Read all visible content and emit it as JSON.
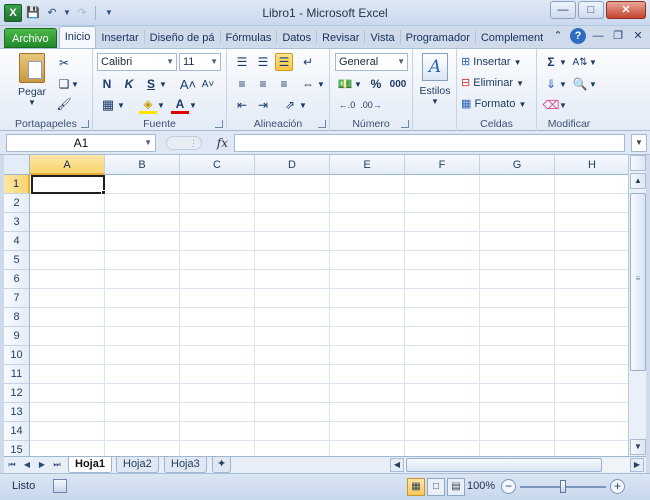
{
  "window": {
    "title": "Libro1 - Microsoft Excel",
    "controls": [
      "minimize-button",
      "maximize-button",
      "close-button"
    ]
  },
  "qat": {
    "app_icon": "X"
  },
  "tabs": [
    {
      "label": "Archivo",
      "key": "file"
    },
    {
      "label": "Inicio",
      "key": "home",
      "active": true
    },
    {
      "label": "Insertar",
      "key": "insert"
    },
    {
      "label": "Diseño de pá",
      "key": "page-layout"
    },
    {
      "label": "Fórmulas",
      "key": "formulas"
    },
    {
      "label": "Datos",
      "key": "data"
    },
    {
      "label": "Revisar",
      "key": "review"
    },
    {
      "label": "Vista",
      "key": "view"
    },
    {
      "label": "Programador",
      "key": "developer"
    },
    {
      "label": "Complement",
      "key": "addins"
    }
  ],
  "ribbon": {
    "clipboard": {
      "label": "Portapapeles",
      "paste": "Pegar"
    },
    "font": {
      "label": "Fuente",
      "font_name": "Calibri",
      "font_size": "11",
      "bold": "N",
      "italic": "K",
      "underline": "S"
    },
    "alignment": {
      "label": "Alineación"
    },
    "number": {
      "label": "Número",
      "format": "General",
      "percent": "%",
      "thousands": "000"
    },
    "styles": {
      "label": "Estilos"
    },
    "cells": {
      "label": "Celdas",
      "insert": "Insertar",
      "delete": "Eliminar",
      "format": "Formato"
    },
    "editing": {
      "label": "Modificar"
    }
  },
  "formula_bar": {
    "name_box": "A1",
    "fx": "fx",
    "formula": ""
  },
  "columns": [
    "A",
    "B",
    "C",
    "D",
    "E",
    "F",
    "G",
    "H"
  ],
  "rows": [
    "1",
    "2",
    "3",
    "4",
    "5",
    "6",
    "7",
    "8",
    "9",
    "10",
    "11",
    "12",
    "13",
    "14",
    "15"
  ],
  "active_cell": "A1",
  "sheets": [
    {
      "name": "Hoja1",
      "active": true
    },
    {
      "name": "Hoja2"
    },
    {
      "name": "Hoja3"
    }
  ],
  "status": {
    "text": "Listo",
    "zoom": "100%",
    "zoom_value": 100
  }
}
